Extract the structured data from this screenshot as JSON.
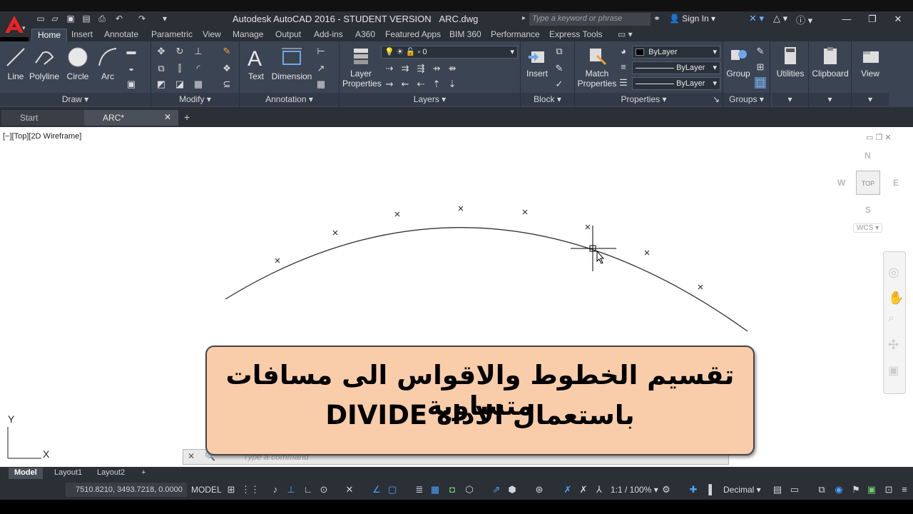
{
  "app": {
    "title": "Autodesk AutoCAD 2016 - STUDENT VERSION",
    "filename": "ARC.dwg",
    "search_placeholder": "Type a keyword or phrase",
    "sign_in": "Sign In"
  },
  "ribbon_tabs": [
    "Home",
    "Insert",
    "Annotate",
    "Parametric",
    "View",
    "Manage",
    "Output",
    "Add-ins",
    "A360",
    "Featured Apps",
    "BIM 360",
    "Performance",
    "Express Tools"
  ],
  "ribbon": {
    "draw": {
      "title": "Draw",
      "line": "Line",
      "polyline": "Polyline",
      "circle": "Circle",
      "arc": "Arc"
    },
    "modify": {
      "title": "Modify"
    },
    "annotation": {
      "title": "Annotation",
      "text": "Text",
      "dimension": "Dimension"
    },
    "layers": {
      "title": "Layers",
      "layer_properties": "Layer Properties",
      "current_layer": "0"
    },
    "block": {
      "title": "Block",
      "insert": "Insert"
    },
    "properties": {
      "title": "Properties",
      "match_properties": "Match Properties",
      "color": "ByLayer",
      "linetype": "ByLayer",
      "lineweight": "ByLayer"
    },
    "groups": {
      "title": "Groups",
      "group": "Group"
    },
    "utilities": "Utilities",
    "clipboard": "Clipboard",
    "view": "View"
  },
  "file_tabs": [
    "Start",
    "ARC*"
  ],
  "viewport_label": "[−][Top][2D Wireframe]",
  "viewcube": {
    "n": "N",
    "s": "S",
    "e": "E",
    "w": "W",
    "face": "TOP",
    "wcs": "WCS"
  },
  "ucs": {
    "y": "Y",
    "x": "X"
  },
  "command_placeholder": "Type  a  command",
  "banner": {
    "line1": "تقسيم الخطوط والاقواس الى مسافات متساوية",
    "line2": "باستعمال الاداة DIVIDE"
  },
  "layout_tabs": [
    "Model",
    "Layout1",
    "Layout2"
  ],
  "status": {
    "coords": "7510.8210, 3493.7218, 0.0000",
    "model": "MODEL",
    "scale": "1:1 / 100%",
    "units": "Decimal"
  }
}
